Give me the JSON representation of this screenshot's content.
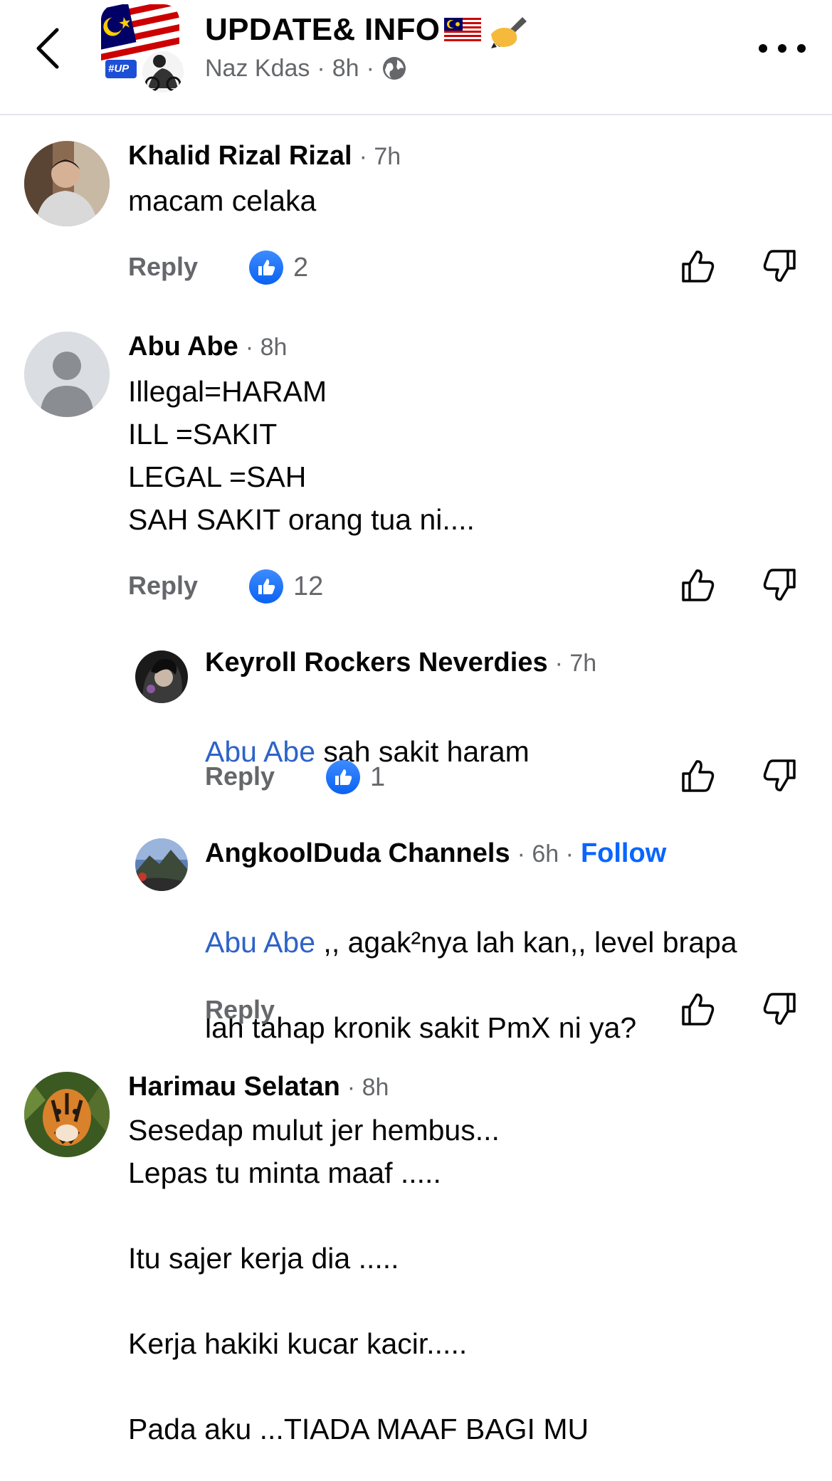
{
  "header": {
    "title": "UPDATE& INFO",
    "title_emojis": [
      "🇲🇾",
      "✍️"
    ],
    "author": "Naz Kdas",
    "time": "8h",
    "separator": "·",
    "audience_icon": "globe-icon",
    "avatar_badge": "#UP"
  },
  "comments": [
    {
      "name": "Khalid Rizal Rizal",
      "time": "· 7h",
      "text": "macam celaka",
      "reply_label": "Reply",
      "reactions": "2"
    },
    {
      "name": "Abu Abe",
      "time": "· 8h",
      "text": "Illegal=HARAM\nILL =SAKIT\nLEGAL =SAH\nSAH SAKIT orang tua ni....",
      "reply_label": "Reply",
      "reactions": "12"
    },
    {
      "name": "Keyroll Rockers Neverdies",
      "time": "· 7h",
      "mention": "Abu Abe",
      "text": " sah sakit haram",
      "reply_label": "Reply",
      "reactions": "1"
    },
    {
      "name": "AngkoolDuda Channels",
      "time": "· 6h ·",
      "follow_label": "Follow",
      "mention": "Abu Abe",
      "text_line1": " ,, agak²nya lah kan,, level brapa",
      "text_line2": "lah tahap kronik sakit PmX ni ya?",
      "reply_label": "Reply"
    },
    {
      "name": "Harimau Selatan",
      "time": "· 8h",
      "text": "Sesedap mulut jer hembus...\nLepas tu minta maaf .....\n\nItu sajer kerja dia .....\n\nKerja hakiki kucar kacir.....\n\nPada aku ...TIADA MAAF BAGI MU"
    }
  ],
  "colors": {
    "like_blue": "#0866ff",
    "mention_blue": "#2e63c7",
    "secondary_text": "#65676b",
    "primary_text": "#050505"
  }
}
